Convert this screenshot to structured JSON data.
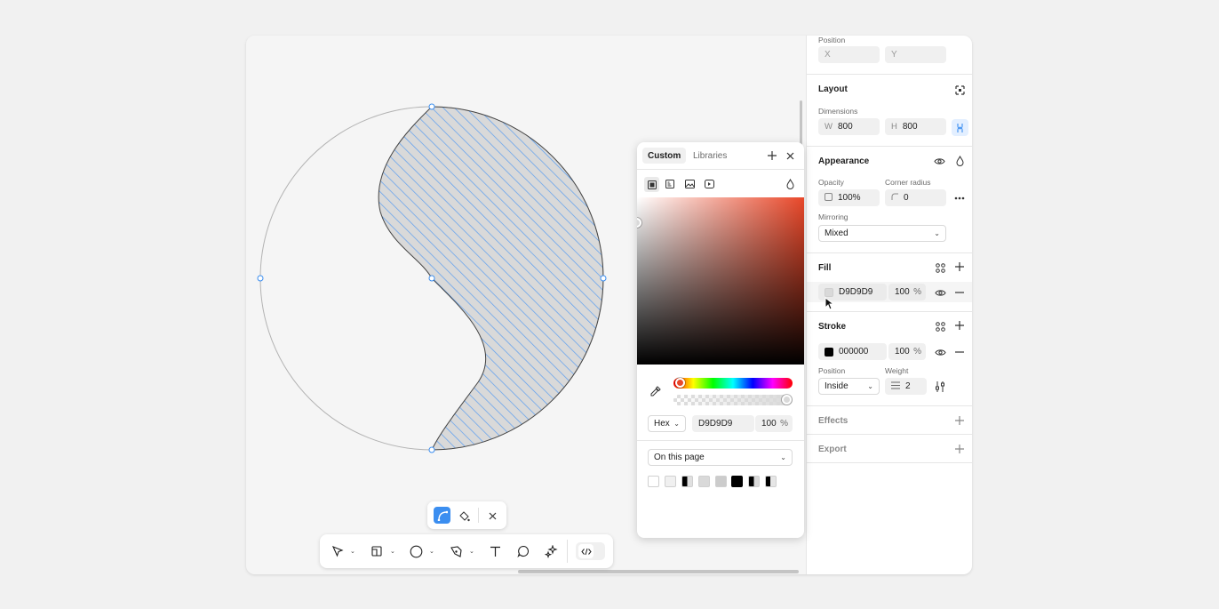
{
  "panel": {
    "position": {
      "label": "Position",
      "x_placeholder": "X",
      "y_placeholder": "Y"
    },
    "layout": {
      "title": "Layout",
      "dimensions_label": "Dimensions",
      "w_prefix": "W",
      "w_value": "800",
      "h_prefix": "H",
      "h_value": "800"
    },
    "appearance": {
      "title": "Appearance",
      "opacity_label": "Opacity",
      "opacity_value": "100%",
      "corner_label": "Corner radius",
      "corner_value": "0",
      "mirroring_label": "Mirroring",
      "mirroring_value": "Mixed"
    },
    "fill": {
      "title": "Fill",
      "hex": "D9D9D9",
      "opacity": "100",
      "pct": "%",
      "swatch_color": "#d9d9d9"
    },
    "stroke": {
      "title": "Stroke",
      "hex": "000000",
      "opacity": "100",
      "pct": "%",
      "swatch_color": "#000000",
      "position_label": "Position",
      "position_value": "Inside",
      "weight_label": "Weight",
      "weight_value": "2"
    },
    "effects": {
      "title": "Effects"
    },
    "export": {
      "title": "Export"
    }
  },
  "picker": {
    "tabs": [
      {
        "label": "Custom",
        "active": true
      },
      {
        "label": "Libraries",
        "active": false
      }
    ],
    "format": "Hex",
    "hex": "D9D9D9",
    "opacity": "100",
    "pct": "%",
    "scope": "On this page",
    "hue_color": "#e9482a",
    "page_swatches": [
      "#ffffff",
      "#f0f0f0",
      "#000000",
      "#d9d9d9",
      "#cccccc",
      "#000000",
      "#000000",
      "#000000"
    ]
  },
  "colors": {
    "accent": "#3b8ef0",
    "shape_fill": "#d9d9d9",
    "hatch": "#5b9ef0"
  }
}
